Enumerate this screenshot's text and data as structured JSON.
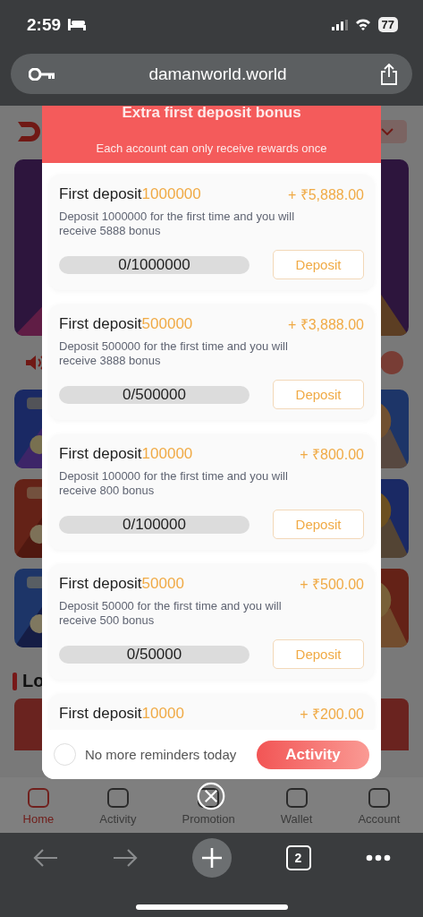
{
  "status_bar": {
    "time": "2:59",
    "battery": "77"
  },
  "browser": {
    "url": "damanworld.world",
    "tab_count": "2"
  },
  "page": {
    "section_title": "Lo",
    "nav": [
      {
        "label": "Home",
        "selected": true
      },
      {
        "label": "Activity",
        "selected": false
      },
      {
        "label": "Promotion",
        "selected": false
      },
      {
        "label": "Wallet",
        "selected": false
      },
      {
        "label": "Account",
        "selected": false
      }
    ]
  },
  "dialog": {
    "title": "Extra first deposit bonus",
    "subtitle": "Each account can only receive rewards once",
    "offers": [
      {
        "title": "First deposit",
        "amount": "1000000",
        "reward": "+ ₹5,888.00",
        "description": "Deposit 1000000 for the first time and you will receive 5888 bonus",
        "progress": "0/1000000",
        "level": 0,
        "button": "Deposit"
      },
      {
        "title": "First deposit",
        "amount": "500000",
        "reward": "+ ₹3,888.00",
        "description": "Deposit 500000 for the first time and you will receive 3888 bonus",
        "progress": "0/500000",
        "level": 0,
        "button": "Deposit"
      },
      {
        "title": "First deposit",
        "amount": "100000",
        "reward": "+ ₹800.00",
        "description": "Deposit 100000 for the first time and you will receive 800 bonus",
        "progress": "0/100000",
        "level": 0,
        "button": "Deposit"
      },
      {
        "title": "First deposit",
        "amount": "50000",
        "reward": "+ ₹500.00",
        "description": "Deposit 50000 for the first time and you will receive 500 bonus",
        "progress": "0/50000",
        "level": 0,
        "button": "Deposit"
      },
      {
        "title": "First deposit",
        "amount": "10000",
        "reward": "+ ₹200.00"
      }
    ],
    "reminder": {
      "label": "No more reminders today",
      "checked": false
    },
    "action": "Activity"
  }
}
